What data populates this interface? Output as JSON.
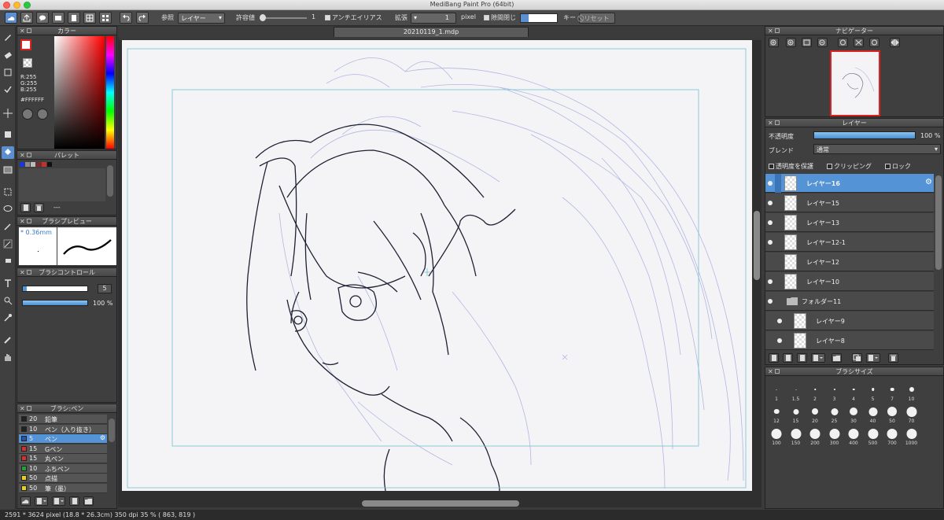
{
  "app": {
    "title": "MediBang Paint Pro (64bit)",
    "doc_tab": "20210119_1.mdp"
  },
  "toolbar": {
    "ref_label": "参照",
    "ref_value": "レイヤー",
    "tolerance_label": "許容値",
    "tolerance_value": "1",
    "antialias_label": "アンチエイリアス",
    "expand_label": "拡張",
    "expand_value": "1",
    "expand_unit": "pixel",
    "gapclose_label": "隙間閉じ",
    "key_label": "キー",
    "reset_label": "リセット"
  },
  "color_panel": {
    "title": "カラー",
    "r": "R:255",
    "g": "G:255",
    "b": "B:255",
    "hex": "#FFFFFF"
  },
  "palette_panel": {
    "title": "パレット",
    "footer": "---",
    "swatches": [
      "#1a37d8",
      "#8a8a8a",
      "#bcbcbc",
      "#7a2a2a",
      "#c43030",
      "#111111"
    ]
  },
  "brush_preview": {
    "title": "ブラシプレビュー",
    "size": "* 0.36mm"
  },
  "brush_control": {
    "title": "ブラシコントロール",
    "size_value": "5",
    "opacity_value": "100 %",
    "size_fraction": 0.06,
    "opacity_fraction": 1.0
  },
  "brush_list": {
    "title": "ブラシ:ペン",
    "items": [
      {
        "num": "20",
        "name": "鉛筆",
        "color": "#222222",
        "sel": false
      },
      {
        "num": "10",
        "name": "ペン（入り抜き）",
        "color": "#222222",
        "sel": false
      },
      {
        "num": "5",
        "name": "ペン",
        "color": "#2a55a0",
        "sel": true
      },
      {
        "num": "15",
        "name": "Gペン",
        "color": "#d83030",
        "sel": false
      },
      {
        "num": "15",
        "name": "丸ペン",
        "color": "#d83030",
        "sel": false
      },
      {
        "num": "10",
        "name": "ふちペン",
        "color": "#22a038",
        "sel": false
      },
      {
        "num": "50",
        "name": "点描",
        "color": "#e8d020",
        "sel": false
      },
      {
        "num": "50",
        "name": "筆（墨）",
        "color": "#e8d020",
        "sel": false
      }
    ]
  },
  "navigator": {
    "title": "ナビゲーター"
  },
  "layer_panel": {
    "title": "レイヤー",
    "opacity_label": "不透明度",
    "opacity_value": "100 %",
    "opacity_fraction": 1.0,
    "blend_label": "ブレンド",
    "blend_value": "通常",
    "protect_label": "透明度を保護",
    "clipping_label": "クリッピング",
    "lock_label": "ロック",
    "layers": [
      {
        "name": "レイヤー16",
        "visible": true,
        "selected": true,
        "indent": 0,
        "folder": false
      },
      {
        "name": "レイヤー15",
        "visible": true,
        "selected": false,
        "indent": 0,
        "folder": false
      },
      {
        "name": "レイヤー13",
        "visible": true,
        "selected": false,
        "indent": 0,
        "folder": false
      },
      {
        "name": "レイヤー12-1",
        "visible": true,
        "selected": false,
        "indent": 0,
        "folder": false
      },
      {
        "name": "レイヤー12",
        "visible": false,
        "selected": false,
        "indent": 0,
        "folder": false
      },
      {
        "name": "レイヤー10",
        "visible": true,
        "selected": false,
        "indent": 0,
        "folder": false
      },
      {
        "name": "フォルダー11",
        "visible": true,
        "selected": false,
        "indent": 0,
        "folder": true
      },
      {
        "name": "レイヤー9",
        "visible": true,
        "selected": false,
        "indent": 1,
        "folder": false
      },
      {
        "name": "レイヤー8",
        "visible": true,
        "selected": false,
        "indent": 1,
        "folder": false
      }
    ]
  },
  "brush_size_panel": {
    "title": "ブラシサイズ",
    "sizes": [
      "1",
      "1.5",
      "2",
      "3",
      "4",
      "5",
      "7",
      "10",
      "12",
      "15",
      "20",
      "25",
      "30",
      "40",
      "50",
      "70",
      "100",
      "150",
      "200",
      "300",
      "400",
      "500",
      "700",
      "1000"
    ]
  },
  "status": {
    "dimensions": "2591 * 3624 pixel  (18.8 * 26.3cm)  350 dpi  35 %  ( 863, 819 )"
  }
}
